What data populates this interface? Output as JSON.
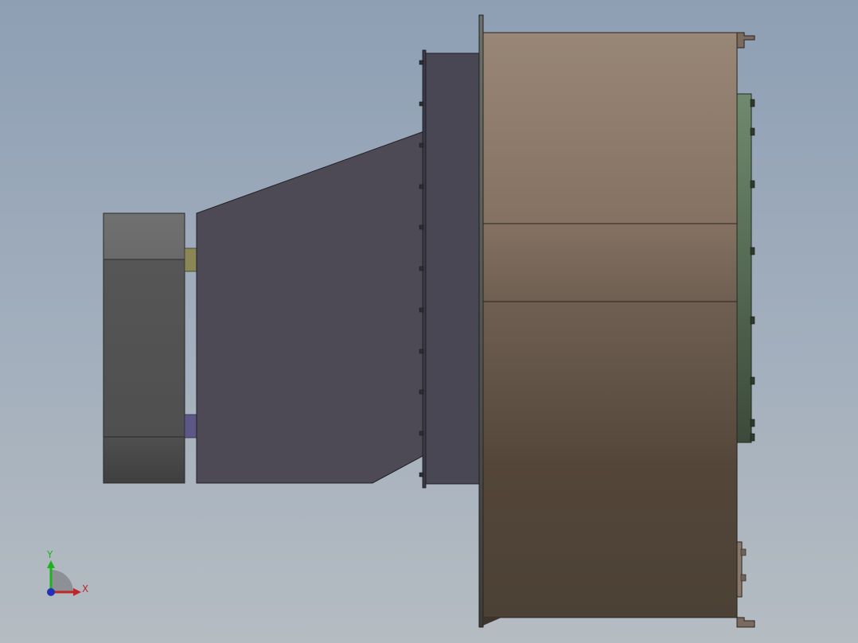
{
  "viewport": {
    "background_top": "#8e9fb4",
    "background_bottom": "#b5bcc2"
  },
  "model": {
    "parts": [
      {
        "name": "motor-body",
        "color": "#58585a"
      },
      {
        "name": "coupling-upper",
        "color": "#8a8655"
      },
      {
        "name": "coupling-lower",
        "color": "#5c5885"
      },
      {
        "name": "inlet-transition-duct",
        "color": "#4d4a56"
      },
      {
        "name": "inlet-flange-block",
        "color": "#4a4754"
      },
      {
        "name": "fan-housing",
        "color": "#5e5046"
      },
      {
        "name": "side-panel",
        "color": "#5e7a5c"
      },
      {
        "name": "bottom-bracket",
        "color": "#7a6a60"
      }
    ]
  },
  "triad": {
    "y_label": "Y",
    "x_label": "X",
    "y_color": "#1db31d",
    "x_color": "#c0262a",
    "z_color": "#2232b8"
  }
}
